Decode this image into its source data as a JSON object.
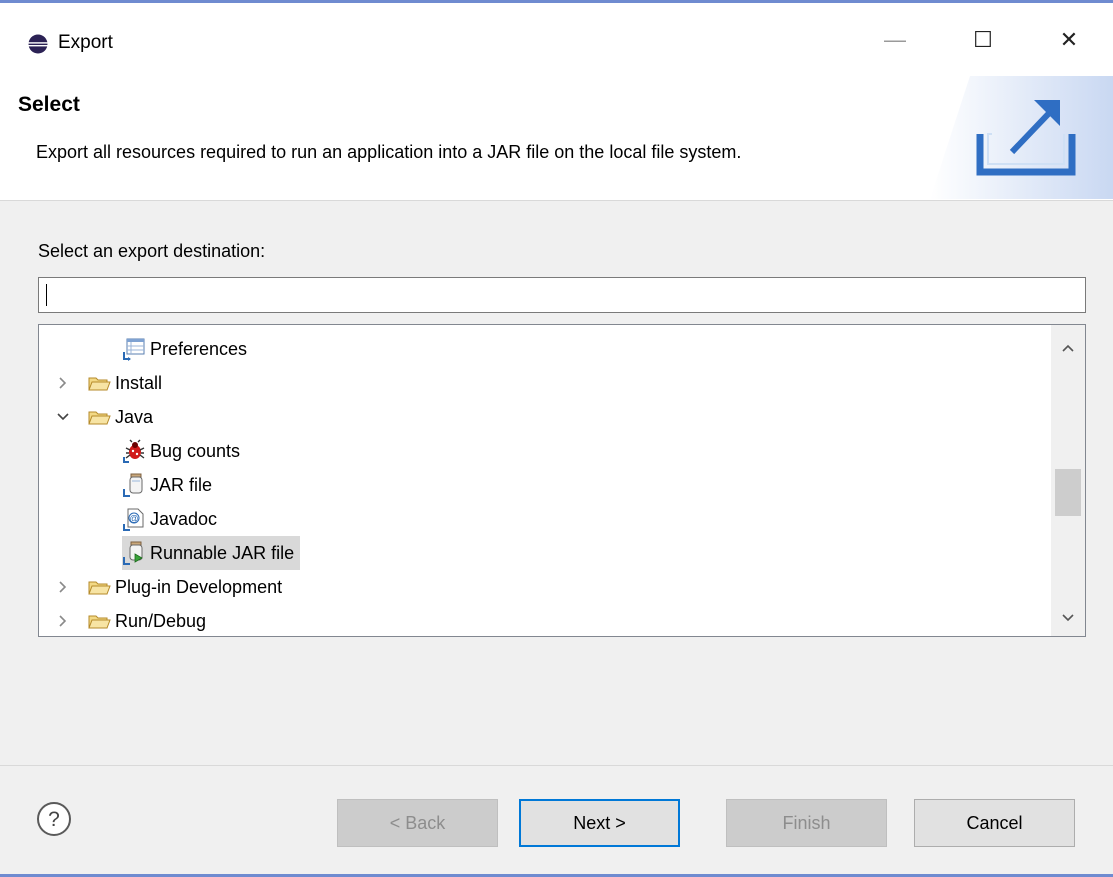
{
  "window": {
    "title": "Export",
    "controls": {
      "minimize": "—",
      "maximize": "☐",
      "close": "✕"
    }
  },
  "header": {
    "title": "Select",
    "description": "Export all resources required to run an application into a JAR file on the local file system.",
    "icon": "export-wizard-icon"
  },
  "body": {
    "destination_label": "Select an export destination:",
    "filter": {
      "value": "",
      "placeholder": ""
    },
    "tree": {
      "selected": "Runnable JAR file",
      "items": [
        {
          "label": "Preferences",
          "icon": "preferences-export-icon",
          "level": 2,
          "expander": "none"
        },
        {
          "label": "Install",
          "icon": "folder-icon",
          "level": 1,
          "expander": "collapsed"
        },
        {
          "label": "Java",
          "icon": "folder-icon",
          "level": 1,
          "expander": "expanded"
        },
        {
          "label": "Bug counts",
          "icon": "bug-icon",
          "level": 2,
          "expander": "none"
        },
        {
          "label": "JAR file",
          "icon": "jar-export-icon",
          "level": 2,
          "expander": "none"
        },
        {
          "label": "Javadoc",
          "icon": "javadoc-icon",
          "level": 2,
          "expander": "none"
        },
        {
          "label": "Runnable JAR file",
          "icon": "runnable-jar-icon",
          "level": 2,
          "expander": "none",
          "selected": true
        },
        {
          "label": "Plug-in Development",
          "icon": "folder-icon",
          "level": 1,
          "expander": "collapsed"
        },
        {
          "label": "Run/Debug",
          "icon": "folder-icon",
          "level": 1,
          "expander": "collapsed"
        }
      ]
    },
    "scrollbar": {
      "position": 0.55,
      "visible_fraction": 0.36
    }
  },
  "footer": {
    "help_icon": "help-icon",
    "buttons": {
      "back": {
        "label": "< Back",
        "enabled": false
      },
      "next": {
        "label": "Next >",
        "enabled": true,
        "default": true
      },
      "finish": {
        "label": "Finish",
        "enabled": false
      },
      "cancel": {
        "label": "Cancel",
        "enabled": true
      }
    }
  },
  "colors": {
    "accent": "#0078d7",
    "window_edge": "#6f8bd0",
    "folder": "#e8c46a",
    "selection": "#d9d9d9"
  }
}
